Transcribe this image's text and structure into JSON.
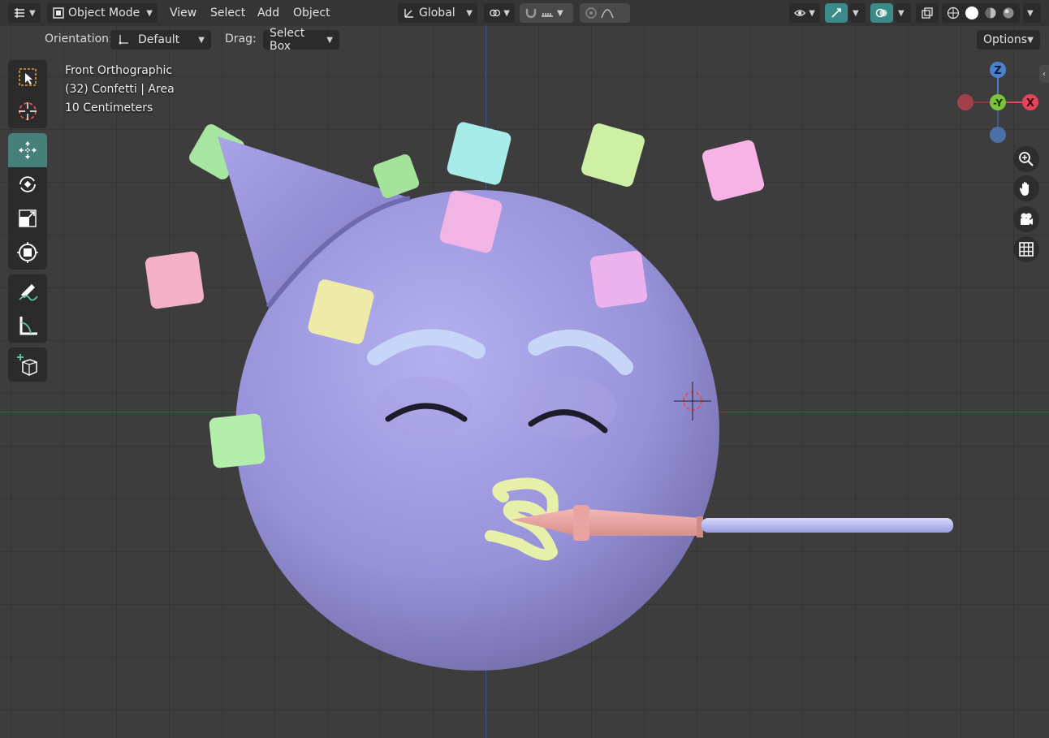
{
  "header": {
    "mode": "Object Mode",
    "menus": [
      "View",
      "Select",
      "Add",
      "Object"
    ],
    "transform_orientation": "Global",
    "options_label": "Options"
  },
  "tool_settings": {
    "orientation_label": "Orientation:",
    "orientation_value": "Default",
    "drag_label": "Drag:",
    "drag_value": "Select Box"
  },
  "overlay": {
    "view_name": "Front Orthographic",
    "object_info": "(32) Confetti | Area",
    "scale": "10 Centimeters"
  },
  "gizmo": {
    "z": "Z",
    "y": "-Y",
    "x": "X"
  },
  "toolbar": {
    "tools": [
      "select-box",
      "cursor",
      "move",
      "rotate",
      "scale",
      "transform",
      "annotate",
      "measure",
      "add-cube"
    ],
    "active_tool": "move"
  },
  "colors": {
    "accent": "#47807a",
    "face": "#9f9be0",
    "grid_bg": "#3d3d3d"
  }
}
